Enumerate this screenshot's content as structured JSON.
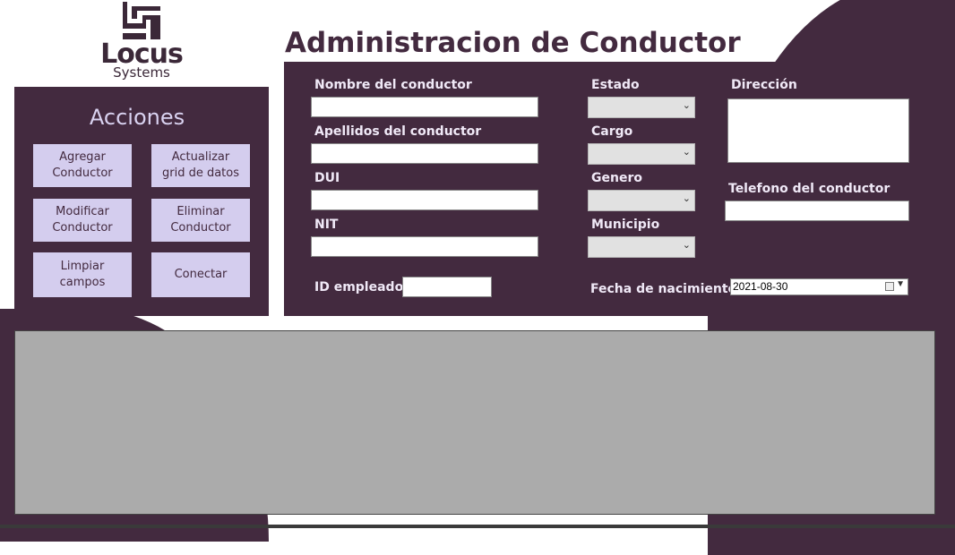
{
  "logo": {
    "word": "Locus",
    "sub": "Systems"
  },
  "title": "Administracion de Conductor",
  "actions": {
    "heading": "Acciones",
    "add": "Agregar\nConductor",
    "refresh": "Actualizar\ngrid de datos",
    "modify": "Modificar\nConductor",
    "delete": "Eliminar\nConductor",
    "clear": "Limpiar\ncampos",
    "connect": "Conectar"
  },
  "form": {
    "nombre_label": "Nombre del conductor",
    "nombre_value": "",
    "apellidos_label": "Apellidos del conductor",
    "apellidos_value": "",
    "dui_label": "DUI",
    "dui_value": "",
    "nit_label": "NIT",
    "nit_value": "",
    "id_label": "ID empleado",
    "id_value": "",
    "estado_label": "Estado",
    "estado_value": "",
    "cargo_label": "Cargo",
    "cargo_value": "",
    "genero_label": "Genero",
    "genero_value": "",
    "municipio_label": "Municipio",
    "municipio_value": "",
    "direccion_label": "Dirección",
    "direccion_value": "",
    "telefono_label": "Telefono del conductor",
    "telefono_value": "",
    "fecha_label": "Fecha de nacimiento",
    "fecha_value": "2021-08-30"
  },
  "colors": {
    "brand": "#432a3f",
    "button": "#d4cdee",
    "grid": "#ababab"
  },
  "icons": {
    "logo": "locus-logo-icon",
    "calendar": "calendar-icon",
    "dropdown": "chevron-down-icon"
  }
}
